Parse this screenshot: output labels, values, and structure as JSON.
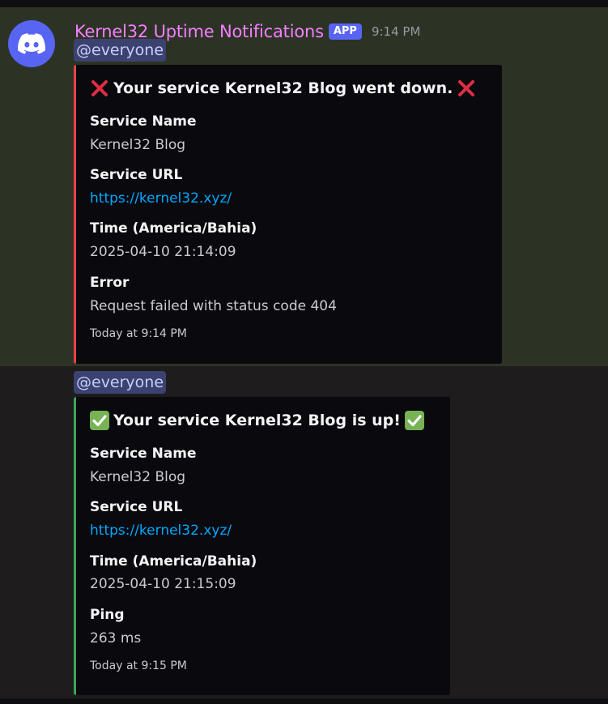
{
  "colors": {
    "accent_red": "#ed4245",
    "accent_green": "#3ba55c",
    "username": "#f47fff",
    "link": "#00a8fc"
  },
  "message": {
    "avatar_icon": "discord-logo-icon",
    "username": "Kernel32 Uptime Notifications",
    "badge": "APP",
    "time": "9:14 PM"
  },
  "embeds": [
    {
      "mention": "@everyone",
      "icon": "cross-mark-icon",
      "title": "Your service Kernel32 Blog went down.",
      "fields": [
        {
          "name": "Service Name",
          "value": "Kernel32 Blog"
        },
        {
          "name": "Service URL",
          "value": "https://kernel32.xyz/"
        },
        {
          "name": "Time (America/Bahia)",
          "value": "2025-04-10 21:14:09"
        },
        {
          "name": "Error",
          "value": "Request failed with status code 404"
        }
      ],
      "footer": "Today at 9:14 PM"
    },
    {
      "mention": "@everyone",
      "icon": "check-mark-icon",
      "title": "Your service Kernel32 Blog is up!",
      "fields": [
        {
          "name": "Service Name",
          "value": "Kernel32 Blog"
        },
        {
          "name": "Service URL",
          "value": "https://kernel32.xyz/"
        },
        {
          "name": "Time (America/Bahia)",
          "value": "2025-04-10 21:15:09"
        },
        {
          "name": "Ping",
          "value": "263 ms"
        }
      ],
      "footer": "Today at 9:15 PM"
    }
  ]
}
